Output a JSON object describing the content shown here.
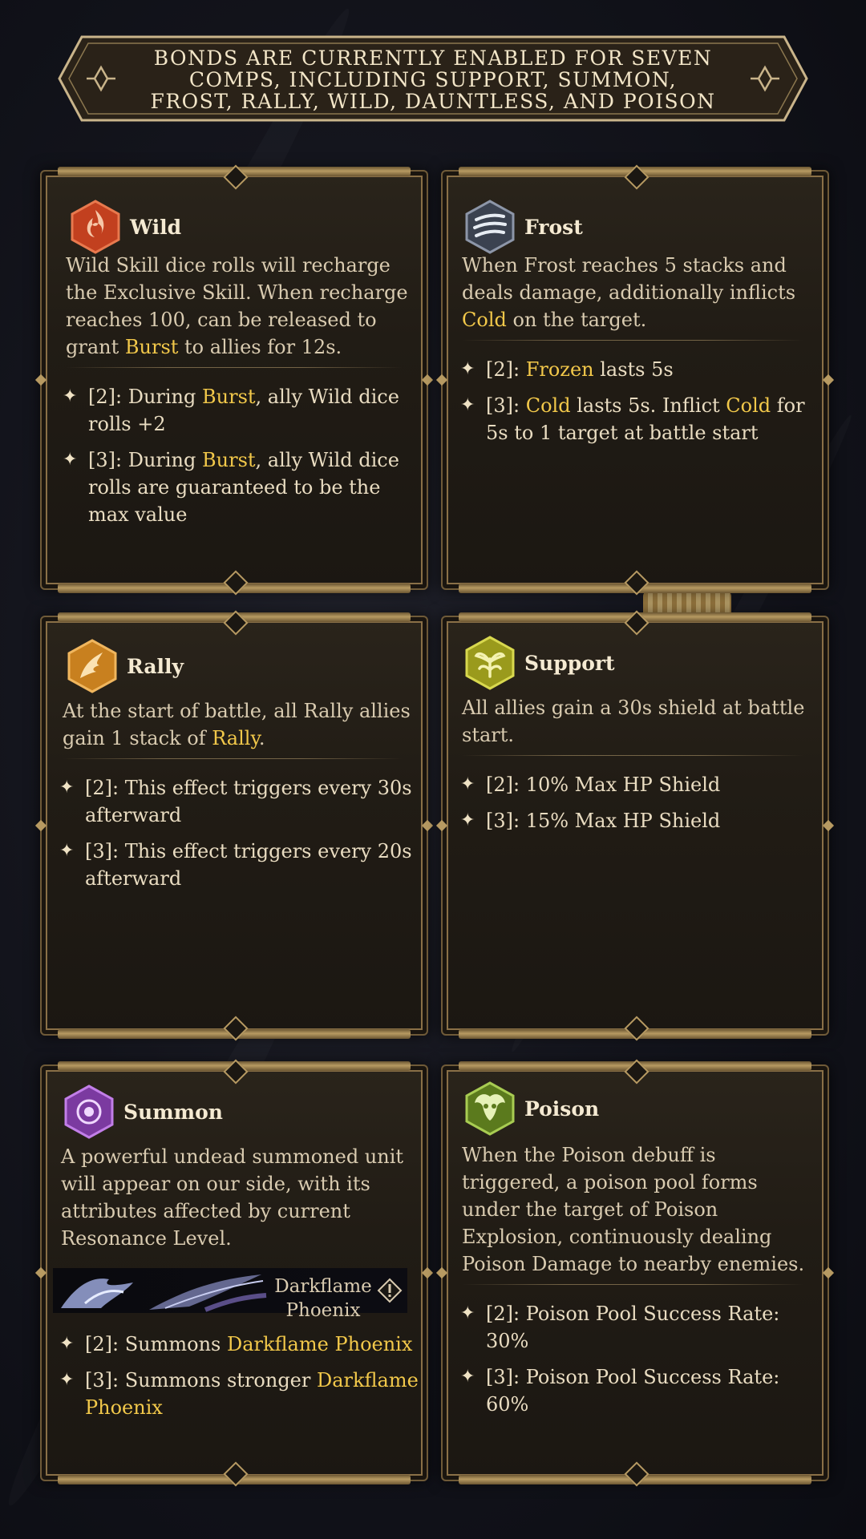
{
  "banner": {
    "text": "BONDS ARE CURRENTLY ENABLED FOR SEVEN COMPS, INCLUDING SUPPORT, SUMMON, FROST, RALLY, WILD, DAUNTLESS, AND POISON"
  },
  "colors": {
    "highlight": "#f2c84a",
    "body_text": "#d9cbb0",
    "title_text": "#f5ead2",
    "frame_gold": "#b79a62",
    "wild_icon": "#c2401f",
    "frost_icon": "#3b4250",
    "rally_icon": "#c8801f",
    "support_icon": "#9a9a1c",
    "summon_icon": "#7b3aa0",
    "poison_icon": "#5b7a1d"
  },
  "cards": {
    "wild": {
      "icon": "wild-flame-icon",
      "title": "Wild",
      "desc": [
        {
          "t": "Wild Skill dice rolls will recharge the Exclusive Skill. When recharge reaches 100, can be released to grant "
        },
        {
          "t": "Burst",
          "hl": true
        },
        {
          "t": " to allies for 12s."
        }
      ],
      "tiers": [
        [
          {
            "t": "[2]: During "
          },
          {
            "t": "Burst",
            "hl": true
          },
          {
            "t": ", ally Wild dice rolls +2"
          }
        ],
        [
          {
            "t": "[3]: During "
          },
          {
            "t": "Burst",
            "hl": true
          },
          {
            "t": ", ally Wild dice rolls are guaranteed to be the max value"
          }
        ]
      ]
    },
    "frost": {
      "icon": "frost-wind-icon",
      "title": "Frost",
      "desc": [
        {
          "t": "When Frost reaches 5 stacks and deals damage, additionally inflicts "
        },
        {
          "t": "Cold",
          "hl": true
        },
        {
          "t": " on the target."
        }
      ],
      "tiers": [
        [
          {
            "t": "[2]: "
          },
          {
            "t": "Frozen",
            "hl": true
          },
          {
            "t": " lasts 5s"
          }
        ],
        [
          {
            "t": "[3]: "
          },
          {
            "t": "Cold",
            "hl": true
          },
          {
            "t": " lasts 5s. Inflict "
          },
          {
            "t": "Cold",
            "hl": true
          },
          {
            "t": " for 5s to 1 target at battle start"
          }
        ]
      ]
    },
    "rally": {
      "icon": "rally-wing-icon",
      "title": "Rally",
      "desc": [
        {
          "t": "At the start of battle, all Rally allies gain 1 stack of "
        },
        {
          "t": "Rally",
          "hl": true
        },
        {
          "t": "."
        }
      ],
      "tiers": [
        [
          {
            "t": "[2]: This effect triggers every 30s afterward"
          }
        ],
        [
          {
            "t": "[3]: This effect triggers every 20s afterward"
          }
        ]
      ]
    },
    "support": {
      "icon": "support-sprout-icon",
      "title": "Support",
      "desc": [
        {
          "t": "All allies gain a 30s shield at battle start."
        }
      ],
      "tiers": [
        [
          {
            "t": "[2]: 10% Max HP Shield"
          }
        ],
        [
          {
            "t": "[3]: 15% Max HP Shield"
          }
        ]
      ]
    },
    "summon": {
      "icon": "summon-eye-icon",
      "title": "Summon",
      "desc": [
        {
          "t": "A powerful undead summoned unit will appear on our side, with its attributes affected by current Resonance Level."
        }
      ],
      "unit_name": "Darkflame Phoenix",
      "tiers": [
        [
          {
            "t": "[2]: Summons "
          },
          {
            "t": "Darkflame Phoenix",
            "hl": true
          }
        ],
        [
          {
            "t": "[3]: Summons stronger "
          },
          {
            "t": "Darkflame Phoenix",
            "hl": true
          }
        ]
      ]
    },
    "poison": {
      "icon": "poison-skull-icon",
      "title": "Poison",
      "desc": [
        {
          "t": "When the Poison debuff is triggered, a poison pool forms under the target of Poison Explosion, continuously dealing Poison Damage to nearby enemies."
        }
      ],
      "tiers": [
        [
          {
            "t": "[2]: Poison Pool Success Rate: 30%"
          }
        ],
        [
          {
            "t": "[3]: Poison Pool Success Rate: 60%"
          }
        ]
      ]
    }
  }
}
